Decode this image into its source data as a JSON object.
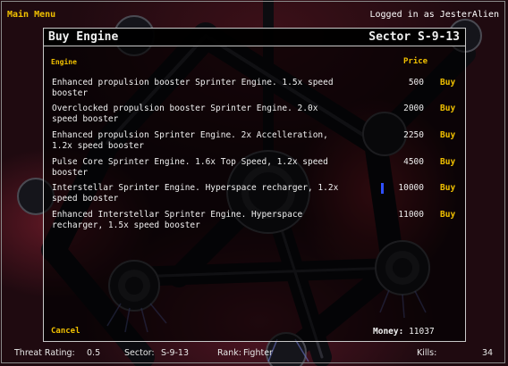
{
  "top_bar": {
    "main_menu_label": "Main Menu",
    "login_status": "Logged in as JesterAlien"
  },
  "dialog": {
    "title": "Buy Engine",
    "sector": "Sector S-9-13",
    "columns": {
      "engine": "Engine",
      "price": "Price"
    },
    "engines": [
      {
        "line1": "Enhanced propulsion booster Sprinter Engine. 1.5x speed",
        "line2": "booster",
        "price": "500",
        "buy": "Buy"
      },
      {
        "line1": "Overclocked propulsion booster Sprinter Engine. 2.0x",
        "line2": "speed booster",
        "price": "2000",
        "buy": "Buy"
      },
      {
        "line1": "Enhanced propulsion Sprinter Engine. 2x Accelleration,",
        "line2": "1.2x speed booster",
        "price": "2250",
        "buy": "Buy"
      },
      {
        "line1": "Pulse Core Sprinter Engine. 1.6x Top Speed, 1.2x speed",
        "line2": "booster",
        "price": "4500",
        "buy": "Buy"
      },
      {
        "line1": "Interstellar Sprinter Engine. Hyperspace recharger, 1.2x",
        "line2": "speed booster",
        "price": "10000",
        "buy": "Buy"
      },
      {
        "line1": "Enhanced Interstellar Sprinter Engine. Hyperspace",
        "line2": "recharger, 1.5x speed booster",
        "price": "11000",
        "buy": "Buy"
      }
    ],
    "cancel_label": "Cancel",
    "money_label": "Money:",
    "money_value": "11037"
  },
  "status_bar": {
    "threat_label": "Threat Rating:",
    "threat_value": "0.5",
    "sector_label": "Sector:",
    "sector_value": "S-9-13",
    "rank_label": "Rank:",
    "rank_value": "Fighter",
    "kills_label": "Kills:",
    "kills_value": "34"
  },
  "colors": {
    "accent_yellow": "#f0c000",
    "text_white": "#f0f0f0",
    "border_gray": "#c8c8c8",
    "cursor_blue": "#2f4fff"
  }
}
